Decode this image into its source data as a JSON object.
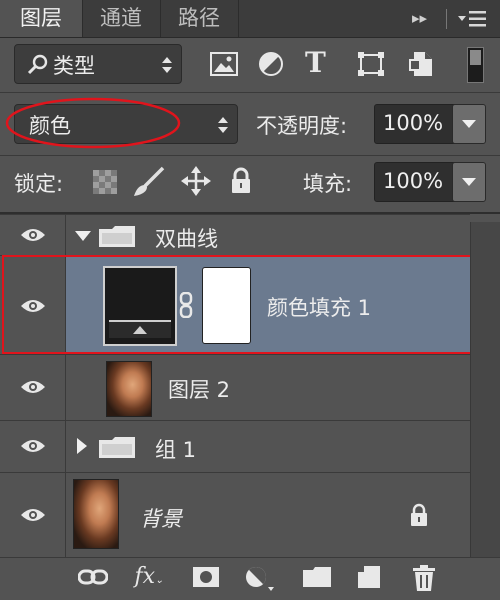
{
  "tabs": [
    "图层",
    "通道",
    "路径"
  ],
  "panel_menu_glyph": "▸▸",
  "filter": {
    "label": "类型"
  },
  "blend_mode": "颜色",
  "opacity": {
    "label": "不透明度:",
    "value": "100%"
  },
  "lock": {
    "label": "锁定:"
  },
  "fill": {
    "label": "填充:",
    "value": "100%"
  },
  "layers": [
    {
      "name": "双曲线",
      "kind": "group",
      "expanded": true
    },
    {
      "name": "颜色填充 1",
      "kind": "fill",
      "selected": true
    },
    {
      "name": "图层 2",
      "kind": "pixel"
    },
    {
      "name": "组 1",
      "kind": "group",
      "expanded": false
    },
    {
      "name": "背景",
      "kind": "background",
      "locked": true
    }
  ],
  "footer_icons": [
    "link-layers-icon",
    "fx-icon",
    "add-mask-icon",
    "adjustment-layer-icon",
    "new-group-icon",
    "new-layer-icon",
    "trash-icon"
  ],
  "colors": {
    "panel": "#535353",
    "selected_row": "#6b7a8f",
    "highlight_border": "#e0141c"
  }
}
